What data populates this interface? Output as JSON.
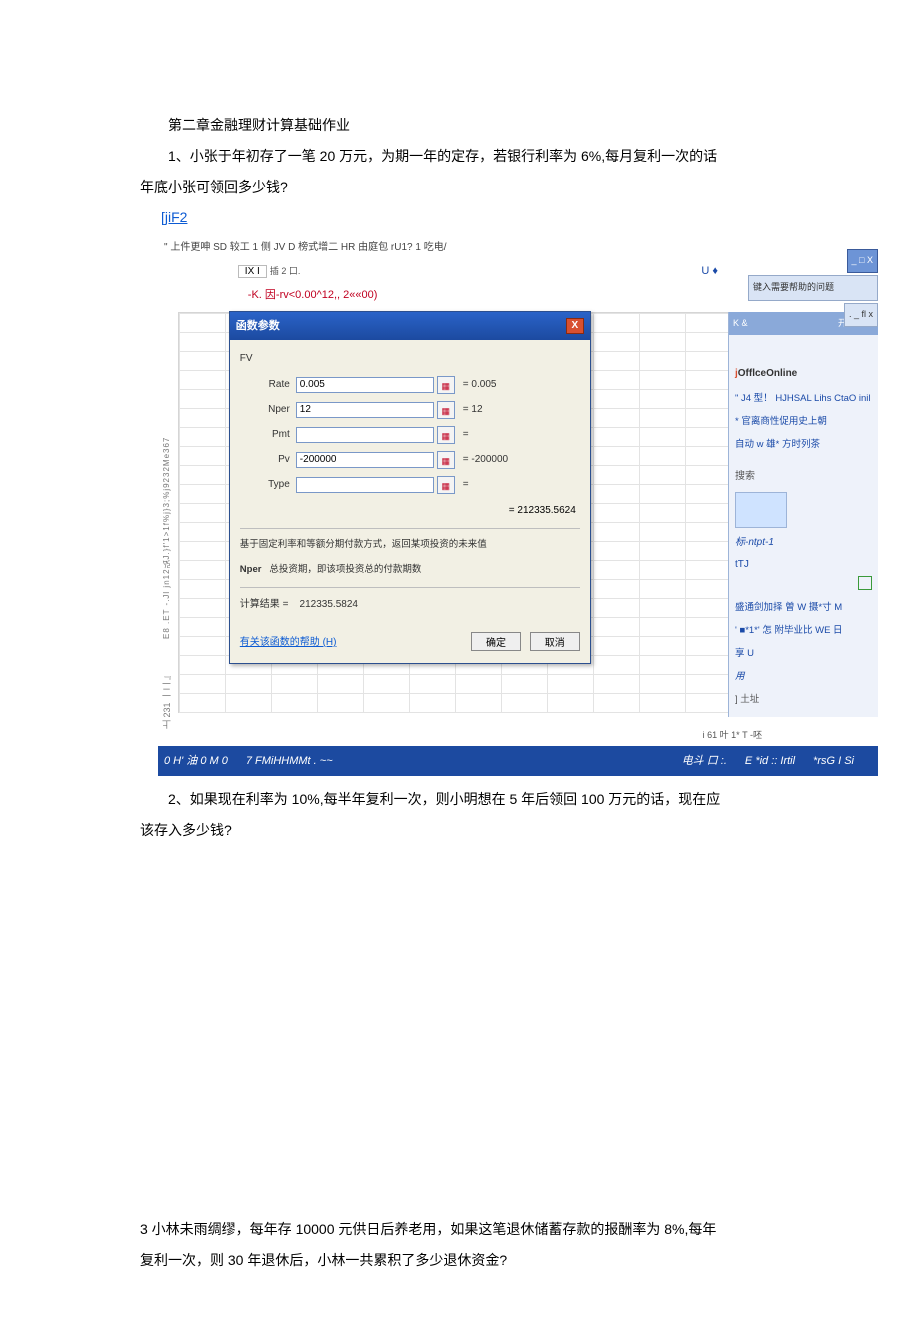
{
  "doc": {
    "chapter_title": "第二章金融理财计算基础作业",
    "q1_line1": "1、小张于年初存了一笔 20 万元，为期一年的定存，若银行利率为 6%,每月复利一次的话",
    "q1_line2": "年底小张可领回多少钱?",
    "q1_code": "[jiF2",
    "q2_line1": "2、如果现在利率为 10%,每半年复利一次，则小明想在 5 年后领回 100 万元的话，现在应",
    "q2_line2": "该存入多少钱?",
    "q3_line1": "3 小林未雨绸缪，每年存 10000 元供日后养老用，如果这笔退休储蓄存款的报酬率为 8%,每年",
    "q3_line2": "复利一次，则 30 年退休后，小林一共累积了多少退休资金?"
  },
  "excel": {
    "toolbar_text": "\" 上件更呻 SD 较工 1 侧 JV D 榜式增二 HR  由庭包  rU1? 1 吃电/",
    "fx_cell": "IX I",
    "fx_suffix": "插 2 口.",
    "formula": "-K. 因-rv<0.00^12,, 2««00)",
    "dialog": {
      "title": "函数参数",
      "group": "FV",
      "rate_label": "Rate",
      "rate_value": "0.005",
      "rate_eq": "= 0.005",
      "nper_label": "Nper",
      "nper_value": "12",
      "nper_eq": "= 12",
      "pmt_label": "Pmt",
      "pmt_value": "",
      "pmt_eq": "=",
      "pv_label": "Pv",
      "pv_value": "-200000",
      "pv_eq": "= -200000",
      "type_label": "Type",
      "type_value": "",
      "type_eq": "=",
      "return_eq": "= 212335.5624",
      "note1": "基于固定利率和等额分期付款方式，返回某项投资的未来值",
      "note2_label": "Nper",
      "note2_text": "总投资期，即该项投资总的付款期数",
      "result_label": "计算结果 =",
      "result_value": "212335.5824",
      "help_link": "有关该函数的帮助 (H)",
      "ok": "确定",
      "cancel": "取消"
    },
    "help_box_text": "键入需要帮助的问题",
    "help_dots": ". _ fl x",
    "u_symbol": "U ♦",
    "right_bar_label": "K &",
    "right_bar_title": "开始工作",
    "task_pane": {
      "office": "OfflceOnline",
      "l1": "\" J4 型！  HJHSAL Lihs CtaO inil",
      "l2": "* 官离商性促用史上朝",
      "l3": " 自动 w 雄* 方时列茶",
      "sect": "搜索",
      "hint": "标-ntpt-1",
      "tj": "tTJ",
      "a1": "盛通剑加择  曽 W 摄*寸 M",
      "a2": "' ■*1*' 怎  附毕业比 WE 日",
      "a3": "享 U",
      "a4": "用",
      "a5": "] 土址"
    },
    "zoom_text": "i 61 叶 1* T -呸",
    "status": {
      "s1": "0 H' 油 0 M 0",
      "s2": "7 FMiHHMMt . ~~",
      "s3": "电斗  口 :.",
      "s4": "E *id  :: Irtil",
      "s5": "*rsG I Si"
    },
    "left_ruler": "E8 .ET  -.Jl jn12弘J.}f'1>1f%j}3;%j9232Me367",
    "left_ruler_b": "上  231  一二  』"
  }
}
